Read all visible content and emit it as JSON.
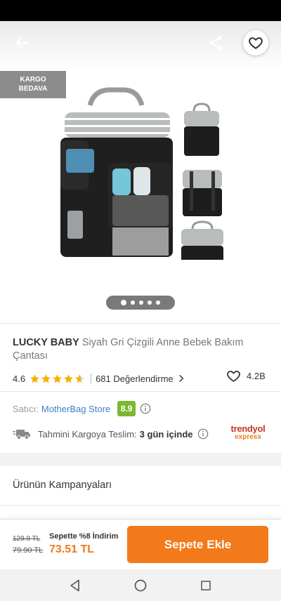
{
  "header": {
    "back_icon": "arrow-left-icon",
    "share_icon": "share-icon",
    "favorite_icon": "heart-outline-icon"
  },
  "gallery": {
    "badge": "KARGO\nBEDAVA",
    "image_count": 5,
    "active_index": 0
  },
  "product": {
    "brand": "LUCKY BABY",
    "name": "Siyah Gri Çizgili Anne Bebek Bakım Çantası",
    "rating": "4.6",
    "rating_value": 4.6,
    "reviews": "681 Değerlendirme",
    "favorites": "4.2B"
  },
  "seller": {
    "label": "Satıcı:",
    "name": "MotherBag Store",
    "score": "8.9"
  },
  "delivery": {
    "label": "Tahmini Kargoya Teslim:",
    "days": "3 gün içinde",
    "logo_line1": "trendyol",
    "logo_line2": "express"
  },
  "campaigns": {
    "heading": "Ürünün Kampanyaları"
  },
  "pricing": {
    "old_price": "129.9 TL",
    "list_price": "79.90 TL",
    "discount_label": "Sepette %8 İndirim",
    "final_price": "73.51 TL",
    "add_to_cart": "Sepete Ekle"
  },
  "colors": {
    "accent": "#f27a1a",
    "seller_score": "#7cb82f",
    "star": "#f6b100",
    "link": "#3d7ec9"
  }
}
